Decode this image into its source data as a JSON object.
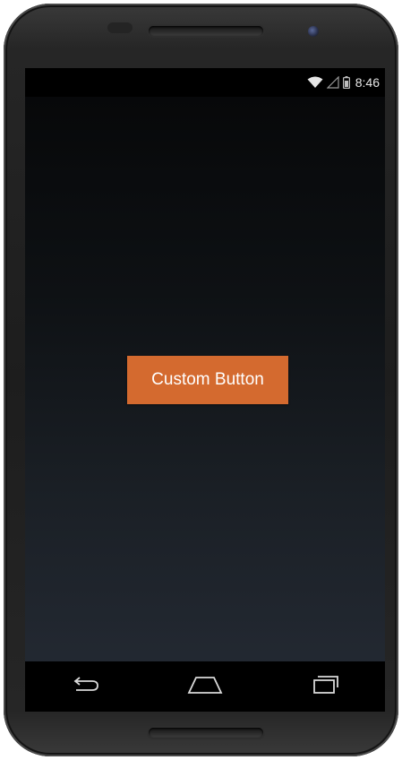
{
  "status_bar": {
    "time": "8:46",
    "icons": [
      "wifi-icon",
      "cell-signal-icon",
      "battery-icon"
    ]
  },
  "main": {
    "custom_button_label": "Custom Button"
  },
  "nav_bar": {
    "buttons": [
      "back-icon",
      "home-icon",
      "recents-icon"
    ]
  },
  "colors": {
    "button": "#d46a2f",
    "button_text": "#ffffff",
    "screen_top": "#060708",
    "screen_bottom": "#252b35",
    "bars": "#000000"
  }
}
